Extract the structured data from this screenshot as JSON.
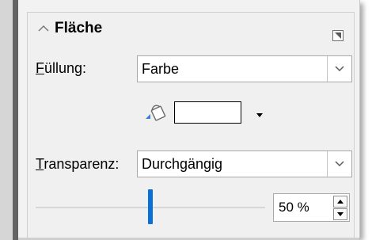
{
  "panel": {
    "title": "Fläche",
    "fill": {
      "label_underlined": "F",
      "label_rest": "üllung:",
      "value": "Farbe"
    },
    "color": {
      "swatch": "#ffffff"
    },
    "transparency": {
      "label_underlined": "T",
      "label_rest": "ransparenz:",
      "value": "Durchgängig"
    },
    "slider": {
      "value_percent": 50
    },
    "spinner": {
      "value": "50 %"
    }
  },
  "icons": [
    "chevron-up-icon",
    "panel-options-icon",
    "chevron-down-icon",
    "paint-bucket-icon",
    "dropdown-triangle-icon",
    "spin-up-icon",
    "spin-down-icon"
  ],
  "colors": {
    "accent": "#0a6fd6",
    "panel": "#f0f0f0"
  }
}
